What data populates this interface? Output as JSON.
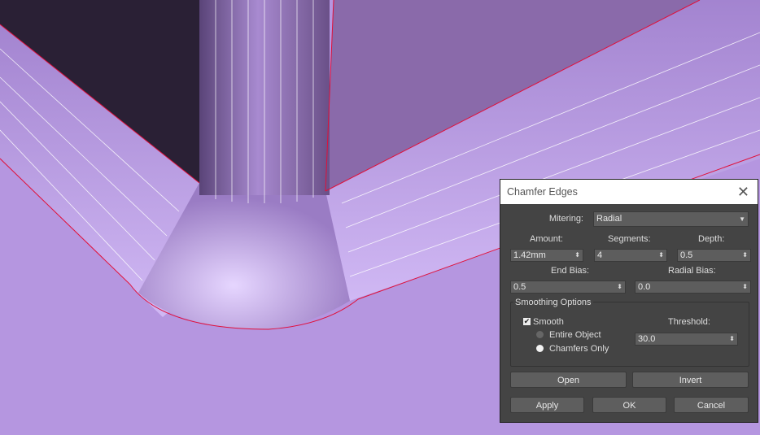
{
  "dialog": {
    "title": "Chamfer Edges",
    "mitering_label": "Mitering:",
    "mitering_value": "Radial",
    "amount_label": "Amount:",
    "amount_value": "1.42mm",
    "segments_label": "Segments:",
    "segments_value": "4",
    "depth_label": "Depth:",
    "depth_value": "0.5",
    "end_bias_label": "End Bias:",
    "end_bias_value": "0.5",
    "radial_bias_label": "Radial Bias:",
    "radial_bias_value": "0.0",
    "smoothing_group": "Smoothing Options",
    "smooth_label": "Smooth",
    "smooth_checked": true,
    "entire_object_label": "Entire Object",
    "chamfers_only_label": "Chamfers Only",
    "selected_option": "Chamfers Only",
    "threshold_label": "Threshold:",
    "threshold_value": "30.0",
    "open_button": "Open",
    "invert_button": "Invert",
    "apply_button": "Apply",
    "ok_button": "OK",
    "cancel_button": "Cancel"
  },
  "colors": {
    "viewport": "#b596e0",
    "edge": "#e0103a",
    "dialog_bg": "#444444"
  }
}
